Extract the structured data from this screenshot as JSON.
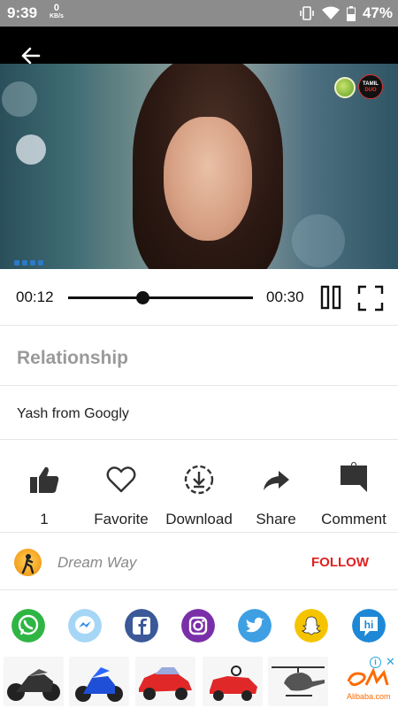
{
  "status_bar": {
    "time": "9:39",
    "network_speed": "0",
    "network_unit": "KB/s",
    "battery": "47%"
  },
  "player": {
    "current_time": "00:12",
    "total_time": "00:30",
    "progress": 0.4,
    "channel_badge_line1": "TAMIL",
    "channel_badge_line2": "DUO"
  },
  "video": {
    "title": "Relationship",
    "subtitle": "Yash from Googly"
  },
  "actions": {
    "like_count": "1",
    "favorite_label": "Favorite",
    "download_label": "Download",
    "share_label": "Share",
    "comment_label": "Comment",
    "comment_count": "0"
  },
  "channel": {
    "name": "Dream Way",
    "follow_label": "FOLLOW"
  },
  "share_targets": [
    "whatsapp-icon",
    "messenger-icon",
    "facebook-icon",
    "instagram-icon",
    "twitter-icon",
    "snapchat-icon",
    "hike-icon"
  ],
  "colors": {
    "follow": "#e02020",
    "whatsapp": "#2fb544",
    "messenger": "#7fc3f0",
    "facebook": "#3b5998",
    "instagram": "#7a2fa8",
    "twitter": "#3f9fe3",
    "snapchat": "#f5c400",
    "hike": "#1e88d6"
  },
  "ad": {
    "brand": "Alibaba.com",
    "info_symbol": "i",
    "close_symbol": "✕"
  }
}
